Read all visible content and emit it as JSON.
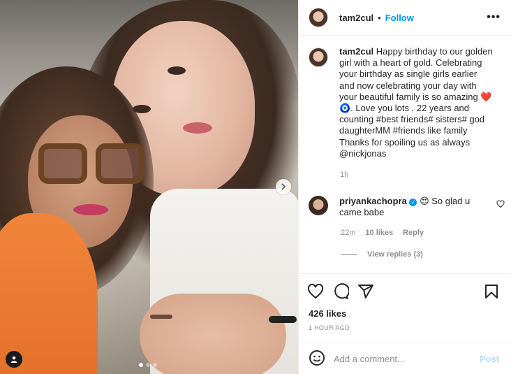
{
  "post": {
    "username": "tam2cul",
    "follow_label": "Follow",
    "separator": "•",
    "more_label": "•••",
    "image_description_label": "",
    "carousel": {
      "count": 3,
      "active_index": 0
    }
  },
  "caption": {
    "username": "tam2cul",
    "text": "Happy birthday to our golden girl with a heart of gold. Celebrating your birthday as single girls earlier and now celebrating your day with your beautiful family is so amazing ❤️🧿. Love you lots . 22 years and counting #best friends# sisters# god daughterMM #friends like family Thanks for spoiling us as always @nickjonas",
    "time": "1h"
  },
  "comment": {
    "username": "priyankachopra",
    "text": "😍 So glad u came babe",
    "time": "22m",
    "likes": "10 likes",
    "reply_label": "Reply",
    "view_replies": "View replies (3)"
  },
  "stats": {
    "likes": "426 likes",
    "posted_ago": "1 HOUR AGO"
  },
  "composer": {
    "placeholder": "Add a comment...",
    "post_label": "Post"
  },
  "colors": {
    "accent": "#0095f6",
    "post_disabled": "#b2dffc",
    "secondary_text": "#8e8e8e"
  },
  "icons": [
    "heart-icon",
    "comment-icon",
    "share-icon",
    "bookmark-icon",
    "emoji-icon",
    "more-icon",
    "next-arrow-icon",
    "user-tag-icon",
    "verified-icon"
  ]
}
